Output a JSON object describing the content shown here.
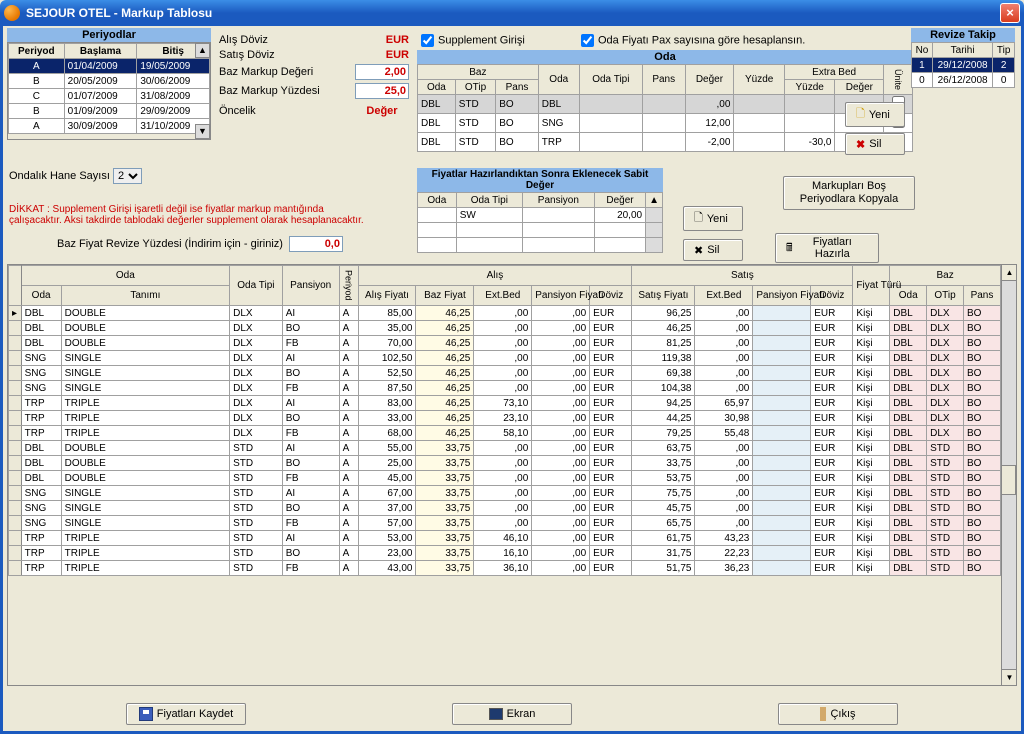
{
  "window": {
    "title": "SEJOUR OTEL - Markup Tablosu"
  },
  "periods": {
    "header": "Periyodlar",
    "cols": [
      "Periyod",
      "Başlama",
      "Bitiş"
    ],
    "rows": [
      {
        "p": "A",
        "s": "01/04/2009",
        "e": "19/05/2009",
        "sel": true
      },
      {
        "p": "B",
        "s": "20/05/2009",
        "e": "30/06/2009"
      },
      {
        "p": "C",
        "s": "01/07/2009",
        "e": "31/08/2009"
      },
      {
        "p": "B",
        "s": "01/09/2009",
        "e": "29/09/2009"
      },
      {
        "p": "A",
        "s": "30/09/2009",
        "e": "31/10/2009"
      }
    ]
  },
  "center": {
    "alis_label": "Alış Döviz",
    "alis_cur": "EUR",
    "satis_label": "Satış Döviz",
    "satis_cur": "EUR",
    "baz_markup_label": "Baz Markup Değeri",
    "baz_markup_val": "2,00",
    "baz_markup_yuz_label": "Baz Markup Yüzdesi",
    "baz_markup_yuz_val": "25,0",
    "oncelik_label": "Öncelik",
    "oncelik_val": "Değer"
  },
  "checks": {
    "supp": "Supplement Girişi",
    "pax": "Oda Fiyatı Pax sayısına göre hesaplansın."
  },
  "oda": {
    "header": "Oda",
    "group_baz": "Baz",
    "group_extra": "Extra Bed",
    "cols": [
      "Oda",
      "OTip",
      "Pans",
      "Oda",
      "Oda Tipi",
      "Pans",
      "Değer",
      "Yüzde",
      "Yüzde",
      "Değer",
      "Ünite"
    ],
    "rows": [
      {
        "c": [
          "DBL",
          "STD",
          "BO",
          "DBL",
          "",
          "",
          ",00",
          "",
          "",
          "",
          ""
        ],
        "grey": true
      },
      {
        "c": [
          "DBL",
          "STD",
          "BO",
          "SNG",
          "",
          "",
          "12,00",
          "",
          "",
          "",
          ""
        ]
      },
      {
        "c": [
          "DBL",
          "STD",
          "BO",
          "TRP",
          "",
          "",
          "-2,00",
          "",
          "-30,0",
          "",
          ""
        ]
      }
    ]
  },
  "revize": {
    "header": "Revize Takip",
    "cols": [
      "No",
      "Tarihi",
      "Tip"
    ],
    "rows": [
      {
        "n": "1",
        "d": "29/12/2008",
        "t": "2",
        "sel": true
      },
      {
        "n": "0",
        "d": "26/12/2008",
        "t": "0"
      }
    ]
  },
  "buttons": {
    "yeni": "Yeni",
    "sil": "Sil",
    "kopyala": "Markupları Boş Periyodlara Kopyala",
    "hazirla": "Fiyatları Hazırla",
    "kaydet": "Fiyatları Kaydet",
    "ekran": "Ekran",
    "cikis": "Çıkış"
  },
  "sabit": {
    "header": "Fiyatlar Hazırlandıktan Sonra Eklenecek Sabit Değer",
    "cols": [
      "Oda",
      "Oda Tipi",
      "Pansiyon",
      "Değer"
    ],
    "rows": [
      {
        "c": [
          "",
          "SW",
          "",
          "20,00"
        ]
      }
    ]
  },
  "ondalik": {
    "label": "Ondalık Hane Sayısı",
    "val": "2"
  },
  "dikkat": "DİKKAT : Supplement Girişi işaretli değil ise fiyatlar markup mantığında çalışacaktır. Aksi takdirde tablodaki değerler supplement olarak hesaplanacaktır.",
  "revyz": {
    "label": "Baz Fiyat Revize Yüzdesi (İndirim için - giriniz)",
    "val": "0,0"
  },
  "grid": {
    "group_oda": "Oda",
    "group_alis": "Alış",
    "group_satis": "Satış",
    "group_fiyat": "Fiyat Türü",
    "group_baz": "Baz",
    "cols_l2": [
      "Oda",
      "Tanımı",
      "Oda Tipi",
      "Pansiyon",
      "Periyod",
      "Alış Fiyatı",
      "Baz Fiyat",
      "Ext.Bed",
      "Pansiyon Fiyatı",
      "Döviz",
      "Satış Fiyatı",
      "Ext.Bed",
      "Pansiyon Fiyatı",
      "Döviz",
      "",
      "Oda",
      "OTip",
      "Pans"
    ],
    "rows": [
      {
        "c": [
          "DBL",
          "DOUBLE",
          "DLX",
          "AI",
          "A",
          "85,00",
          "46,25",
          ",00",
          ",00",
          "EUR",
          "96,25",
          ",00",
          "",
          "EUR",
          "Kişi",
          "DBL",
          "DLX",
          "BO"
        ]
      },
      {
        "c": [
          "DBL",
          "DOUBLE",
          "DLX",
          "BO",
          "A",
          "35,00",
          "46,25",
          ",00",
          ",00",
          "EUR",
          "46,25",
          ",00",
          "",
          "EUR",
          "Kişi",
          "DBL",
          "DLX",
          "BO"
        ]
      },
      {
        "c": [
          "DBL",
          "DOUBLE",
          "DLX",
          "FB",
          "A",
          "70,00",
          "46,25",
          ",00",
          ",00",
          "EUR",
          "81,25",
          ",00",
          "",
          "EUR",
          "Kişi",
          "DBL",
          "DLX",
          "BO"
        ]
      },
      {
        "c": [
          "SNG",
          "SINGLE",
          "DLX",
          "AI",
          "A",
          "102,50",
          "46,25",
          ",00",
          ",00",
          "EUR",
          "119,38",
          ",00",
          "",
          "EUR",
          "Kişi",
          "DBL",
          "DLX",
          "BO"
        ]
      },
      {
        "c": [
          "SNG",
          "SINGLE",
          "DLX",
          "BO",
          "A",
          "52,50",
          "46,25",
          ",00",
          ",00",
          "EUR",
          "69,38",
          ",00",
          "",
          "EUR",
          "Kişi",
          "DBL",
          "DLX",
          "BO"
        ]
      },
      {
        "c": [
          "SNG",
          "SINGLE",
          "DLX",
          "FB",
          "A",
          "87,50",
          "46,25",
          ",00",
          ",00",
          "EUR",
          "104,38",
          ",00",
          "",
          "EUR",
          "Kişi",
          "DBL",
          "DLX",
          "BO"
        ]
      },
      {
        "c": [
          "TRP",
          "TRIPLE",
          "DLX",
          "AI",
          "A",
          "83,00",
          "46,25",
          "73,10",
          ",00",
          "EUR",
          "94,25",
          "65,97",
          "",
          "EUR",
          "Kişi",
          "DBL",
          "DLX",
          "BO"
        ]
      },
      {
        "c": [
          "TRP",
          "TRIPLE",
          "DLX",
          "BO",
          "A",
          "33,00",
          "46,25",
          "23,10",
          ",00",
          "EUR",
          "44,25",
          "30,98",
          "",
          "EUR",
          "Kişi",
          "DBL",
          "DLX",
          "BO"
        ]
      },
      {
        "c": [
          "TRP",
          "TRIPLE",
          "DLX",
          "FB",
          "A",
          "68,00",
          "46,25",
          "58,10",
          ",00",
          "EUR",
          "79,25",
          "55,48",
          "",
          "EUR",
          "Kişi",
          "DBL",
          "DLX",
          "BO"
        ]
      },
      {
        "c": [
          "DBL",
          "DOUBLE",
          "STD",
          "AI",
          "A",
          "55,00",
          "33,75",
          ",00",
          ",00",
          "EUR",
          "63,75",
          ",00",
          "",
          "EUR",
          "Kişi",
          "DBL",
          "STD",
          "BO"
        ]
      },
      {
        "c": [
          "DBL",
          "DOUBLE",
          "STD",
          "BO",
          "A",
          "25,00",
          "33,75",
          ",00",
          ",00",
          "EUR",
          "33,75",
          ",00",
          "",
          "EUR",
          "Kişi",
          "DBL",
          "STD",
          "BO"
        ]
      },
      {
        "c": [
          "DBL",
          "DOUBLE",
          "STD",
          "FB",
          "A",
          "45,00",
          "33,75",
          ",00",
          ",00",
          "EUR",
          "53,75",
          ",00",
          "",
          "EUR",
          "Kişi",
          "DBL",
          "STD",
          "BO"
        ]
      },
      {
        "c": [
          "SNG",
          "SINGLE",
          "STD",
          "AI",
          "A",
          "67,00",
          "33,75",
          ",00",
          ",00",
          "EUR",
          "75,75",
          ",00",
          "",
          "EUR",
          "Kişi",
          "DBL",
          "STD",
          "BO"
        ]
      },
      {
        "c": [
          "SNG",
          "SINGLE",
          "STD",
          "BO",
          "A",
          "37,00",
          "33,75",
          ",00",
          ",00",
          "EUR",
          "45,75",
          ",00",
          "",
          "EUR",
          "Kişi",
          "DBL",
          "STD",
          "BO"
        ]
      },
      {
        "c": [
          "SNG",
          "SINGLE",
          "STD",
          "FB",
          "A",
          "57,00",
          "33,75",
          ",00",
          ",00",
          "EUR",
          "65,75",
          ",00",
          "",
          "EUR",
          "Kişi",
          "DBL",
          "STD",
          "BO"
        ]
      },
      {
        "c": [
          "TRP",
          "TRIPLE",
          "STD",
          "AI",
          "A",
          "53,00",
          "33,75",
          "46,10",
          ",00",
          "EUR",
          "61,75",
          "43,23",
          "",
          "EUR",
          "Kişi",
          "DBL",
          "STD",
          "BO"
        ]
      },
      {
        "c": [
          "TRP",
          "TRIPLE",
          "STD",
          "BO",
          "A",
          "23,00",
          "33,75",
          "16,10",
          ",00",
          "EUR",
          "31,75",
          "22,23",
          "",
          "EUR",
          "Kişi",
          "DBL",
          "STD",
          "BO"
        ]
      },
      {
        "c": [
          "TRP",
          "TRIPLE",
          "STD",
          "FB",
          "A",
          "43,00",
          "33,75",
          "36,10",
          ",00",
          "EUR",
          "51,75",
          "36,23",
          "",
          "EUR",
          "Kişi",
          "DBL",
          "STD",
          "BO"
        ]
      }
    ]
  }
}
